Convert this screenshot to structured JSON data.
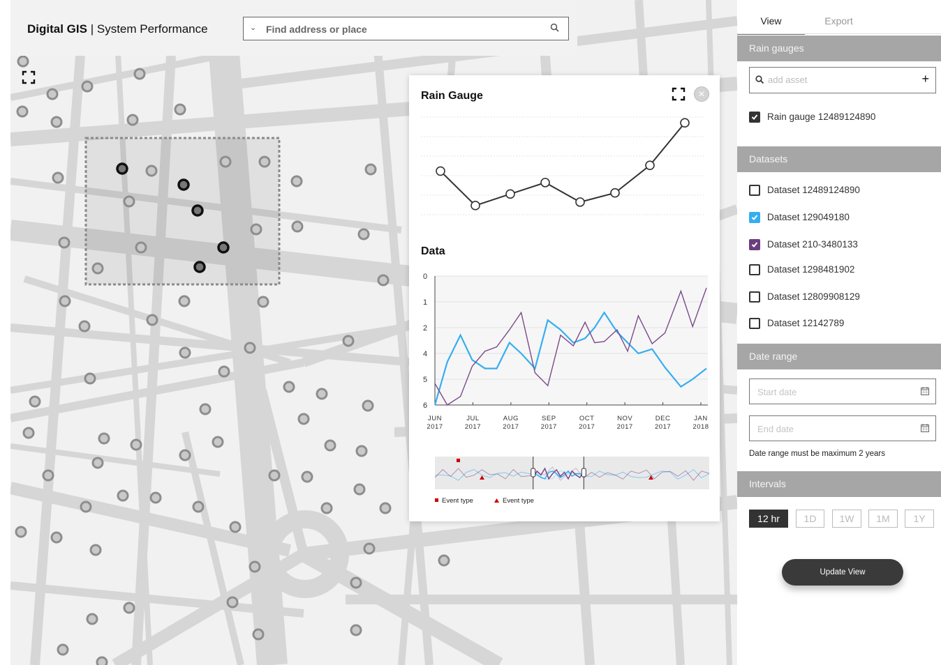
{
  "header": {
    "brand": "Digital GIS",
    "separator": "|",
    "subtitle": "System Performance",
    "search_placeholder": "Find address or place"
  },
  "popup": {
    "title": "Rain Gauge",
    "data_title": "Data",
    "legend": [
      {
        "label": "Event type",
        "icon": "square-marker",
        "color": "#cc0000"
      },
      {
        "label": "Event type",
        "icon": "triangle-marker",
        "color": "#cc0000"
      }
    ]
  },
  "chart_data": [
    {
      "type": "line",
      "title": "Rain Gauge",
      "series": [
        {
          "values": [
            6.3,
            3.3,
            4.3,
            5.3,
            3.6,
            4.4,
            6.8,
            10.5
          ],
          "color": "#333333"
        }
      ],
      "grid": true,
      "axes_visible": false
    },
    {
      "type": "line",
      "title": "Data",
      "y_tick_labels": [
        "0",
        "1",
        "2",
        "4",
        "5",
        "6"
      ],
      "y_direction": "inverted",
      "x_tick_labels": [
        [
          "JUN",
          "2017"
        ],
        [
          "JUL",
          "2017"
        ],
        [
          "AUG",
          "2017"
        ],
        [
          "SEP",
          "2017"
        ],
        [
          "OCT",
          "2017"
        ],
        [
          "NOV",
          "2017"
        ],
        [
          "DEC",
          "2017"
        ],
        [
          "JAN",
          "2018"
        ]
      ],
      "x": [
        0,
        0.58,
        1.2,
        1.75,
        2.35,
        2.9,
        3.5,
        4.05,
        4.7,
        5.3,
        5.9,
        6.5,
        7.05,
        7.5,
        7.95,
        8.55,
        9.05,
        9.55,
        10.2,
        10.8,
        11.55,
        12.1,
        12.75
      ],
      "series": [
        {
          "color": "#35aef0",
          "values": [
            6,
            4,
            2.75,
            3.9,
            4.3,
            4.3,
            3.1,
            3.6,
            4.3,
            2.05,
            2.5,
            3.1,
            2.9,
            2.4,
            1.7,
            2.6,
            3.1,
            3.6,
            3.4,
            4.25,
            5.15,
            4.8,
            4.3
          ]
        },
        {
          "color": "#7a4a8a",
          "values": [
            5,
            6,
            5.6,
            4.2,
            3.5,
            3.3,
            2.5,
            1.7,
            4.5,
            5.1,
            2.75,
            3.25,
            2.15,
            3.1,
            3.05,
            2.5,
            3.5,
            1.85,
            3.15,
            2.65,
            0.7,
            2.35,
            0.55
          ]
        }
      ],
      "grid": true
    },
    {
      "type": "line",
      "title": "Data overview (range selector)",
      "series": [
        {
          "color": "#35aef0",
          "values": [
            0.5,
            0.45,
            0.35,
            0.3,
            0.55,
            0.6,
            0.5,
            0.35,
            0.45,
            0.6,
            0.4,
            0.5
          ]
        },
        {
          "color": "#7a4a8a",
          "values": [
            0.35,
            0.6,
            0.45,
            0.7,
            0.3,
            0.5,
            0.65,
            0.4,
            0.55,
            0.3,
            0.6,
            0.45
          ]
        }
      ],
      "events": [
        {
          "type": "square",
          "color": "#cc0000"
        },
        {
          "type": "triangle",
          "color": "#cc0000"
        },
        {
          "type": "triangle",
          "color": "#cc0000"
        }
      ],
      "selection": {
        "start": 0.18,
        "end": 0.31
      }
    }
  ],
  "panel": {
    "tabs": [
      {
        "label": "View",
        "active": true
      },
      {
        "label": "Export",
        "active": false
      }
    ],
    "rain_gauges": {
      "header": "Rain gauges",
      "add_placeholder": "add asset",
      "add_symbol": "+",
      "items": [
        {
          "label": "Rain gauge 12489124890",
          "checked": true
        }
      ]
    },
    "datasets": {
      "header": "Datasets",
      "items": [
        {
          "label": "Dataset 12489124890",
          "checked": false
        },
        {
          "label": "Dataset 129049180",
          "checked": true,
          "color": "#35aef0"
        },
        {
          "label": "Dataset 210-3480133",
          "checked": true,
          "color": "#6b3d80"
        },
        {
          "label": "Dataset 1298481902",
          "checked": false
        },
        {
          "label": "Dataset 12809908129",
          "checked": false
        },
        {
          "label": "Dataset 12142789",
          "checked": false
        }
      ]
    },
    "date_range": {
      "header": "Date range",
      "start_placeholder": "Start date",
      "end_placeholder": "End date",
      "note": "Date range must be maximum 2 years"
    },
    "intervals": {
      "header": "Intervals",
      "options": [
        {
          "label": "12 hr",
          "active": true
        },
        {
          "label": "1D",
          "active": false
        },
        {
          "label": "1W",
          "active": false
        },
        {
          "label": "1M",
          "active": false
        },
        {
          "label": "1Y",
          "active": false
        }
      ]
    },
    "update_label": "Update View"
  },
  "colors": {
    "map_background": "#f1f1f1",
    "road": "#d6d6d6",
    "section_header": "#a6a6a6",
    "series_blue": "#35aef0",
    "series_purple": "#7a4a8a",
    "event_red": "#cc0000"
  }
}
